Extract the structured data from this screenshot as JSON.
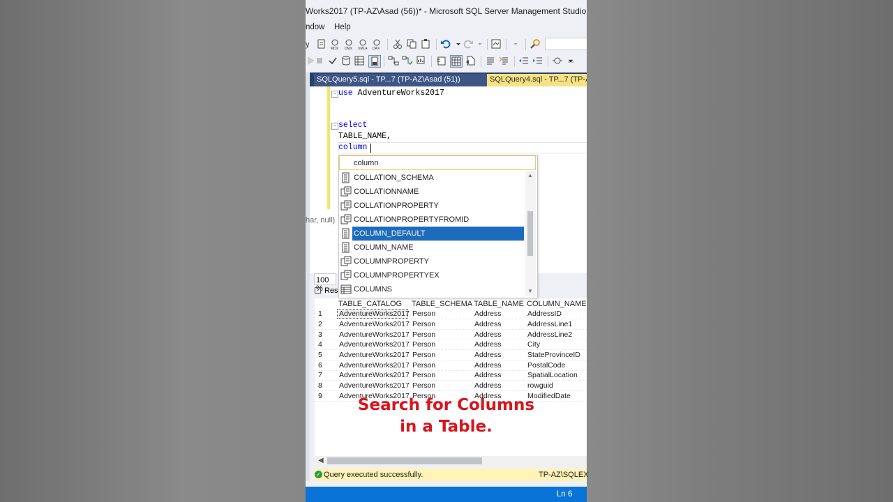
{
  "window": {
    "title": "Works2017 (TP-AZ\\Asad (56))* - Microsoft SQL Server Management Studio"
  },
  "menu": [
    "ndow",
    "Help"
  ],
  "tabs": [
    {
      "label": "SQLQuery5.sql - TP...7 (TP-AZ\\Asad (51))",
      "active": false
    },
    {
      "label": "SQLQuery4.sql - TP...7 (TP-AZ",
      "active": true
    }
  ],
  "editor": {
    "lines": [
      {
        "kw": "use",
        "text": " AdventureWorks2017"
      },
      {
        "kw": "select",
        "text": ""
      },
      {
        "kw": "",
        "text": "TABLE_NAME,"
      },
      {
        "kw": "",
        "text": "column"
      }
    ],
    "tooltip_fragment": "har, null)"
  },
  "autocomplete": {
    "filter": "column",
    "items": [
      {
        "label": "COLLATION_SCHEMA",
        "icon": "column-icon"
      },
      {
        "label": "COLLATIONNAME",
        "icon": "function-icon"
      },
      {
        "label": "COLLATIONPROPERTY",
        "icon": "function-icon"
      },
      {
        "label": "COLLATIONPROPERTYFROMID",
        "icon": "function-icon"
      },
      {
        "label": "COLUMN_DEFAULT",
        "icon": "column-icon",
        "selected": true
      },
      {
        "label": "COLUMN_NAME",
        "icon": "column-icon"
      },
      {
        "label": "COLUMNPROPERTY",
        "icon": "function-icon"
      },
      {
        "label": "COLUMNPROPERTYEX",
        "icon": "function-icon"
      },
      {
        "label": "COLUMNS",
        "icon": "view-icon"
      }
    ]
  },
  "zoom": "100 %",
  "results_tab": "Resu",
  "grid": {
    "headers": [
      "TABLE_CATALOG",
      "TABLE_SCHEMA",
      "TABLE_NAME",
      "COLUMN_NAME"
    ],
    "rows": [
      [
        "1",
        "AdventureWorks2017",
        "Person",
        "Address",
        "AddressID"
      ],
      [
        "2",
        "AdventureWorks2017",
        "Person",
        "Address",
        "AddressLine1"
      ],
      [
        "3",
        "AdventureWorks2017",
        "Person",
        "Address",
        "AddressLine2"
      ],
      [
        "4",
        "AdventureWorks2017",
        "Person",
        "Address",
        "City"
      ],
      [
        "5",
        "AdventureWorks2017",
        "Person",
        "Address",
        "StateProvinceID"
      ],
      [
        "6",
        "AdventureWorks2017",
        "Person",
        "Address",
        "PostalCode"
      ],
      [
        "7",
        "AdventureWorks2017",
        "Person",
        "Address",
        "SpatialLocation"
      ],
      [
        "8",
        "AdventureWorks2017",
        "Person",
        "Address",
        "rowguid"
      ],
      [
        "9",
        "AdventureWorks2017",
        "Person",
        "Address",
        "ModifiedDate"
      ]
    ]
  },
  "query_status": {
    "message": "Query executed successfully.",
    "server": "TP-AZ\\SQLEX"
  },
  "statusbar": {
    "position": "Ln 6"
  },
  "caption": {
    "line1": "Search for Columns",
    "line2": "in a Table."
  },
  "colors": {
    "accent": "#0a74d6",
    "selection": "#1c6bbd",
    "caption": "#d8141c",
    "keyword": "#0000ff"
  }
}
